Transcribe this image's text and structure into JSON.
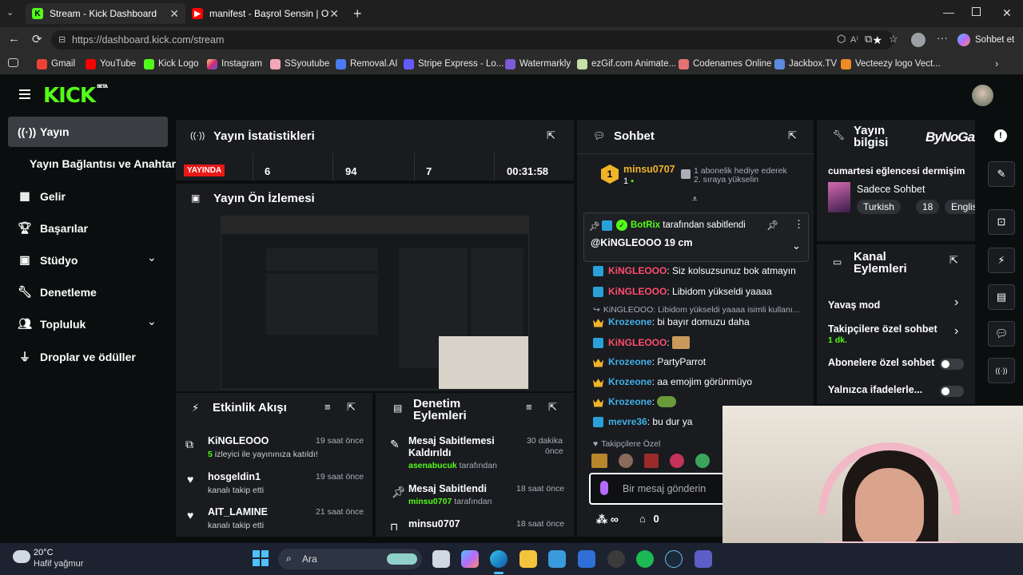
{
  "browser": {
    "tabs": [
      {
        "title": "Stream - Kick Dashboard",
        "active": true
      },
      {
        "title": "manifest - Başrol Sensin | Official M",
        "active": false
      }
    ],
    "url": "https://dashboard.kick.com/stream",
    "sidebar_button": "Sohbet et",
    "bookmarks": [
      "Gmail",
      "YouTube",
      "Kick Logo",
      "Instagram",
      "SSyoutube",
      "Removal.AI",
      "Stripe Express - Lo...",
      "Watermarkly",
      "ezGif.com Animate...",
      "Codenames Online",
      "Jackbox.TV",
      "Vecteezy logo Vect..."
    ]
  },
  "kick": {
    "logo": "KICK",
    "logo_tag": "BETA",
    "sidebar": {
      "items": [
        {
          "label": "Yayın",
          "active": true
        },
        {
          "label": "Yayın Bağlantısı ve Anahtarı"
        },
        {
          "label": "Gelir"
        },
        {
          "label": "Başarılar"
        },
        {
          "label": "Stüdyo"
        },
        {
          "label": "Denetleme"
        },
        {
          "label": "Topluluk"
        },
        {
          "label": "Droplar ve ödüller"
        }
      ]
    },
    "stats": {
      "title": "Yayın İstatistikleri",
      "live_badge": "YAYINDA",
      "values": [
        "6",
        "94",
        "7",
        "00:31:58"
      ]
    },
    "preview": {
      "title": "Yayın Ön İzlemesi"
    },
    "activity": {
      "title": "Etkinlik Akışı",
      "items": [
        {
          "name": "KiNGLEOOO",
          "time": "19 saat önce",
          "count": "5",
          "detail": "izleyici ile yayınınıza katıldı!"
        },
        {
          "name": "hosgeldin1",
          "time": "19 saat önce",
          "detail": "kanalı takip etti"
        },
        {
          "name": "AIT_LAMINE",
          "time": "21 saat önce",
          "detail": "kanalı takip etti"
        }
      ]
    },
    "moderation": {
      "title_line1": "Denetim",
      "title_line2": "Eylemleri",
      "items": [
        {
          "action_line1": "Mesaj Sabitlemesi",
          "action_line2": "Kaldırıldı",
          "time_line1": "30 dakika",
          "time_line2": "önce",
          "user": "asenabucuk",
          "by": "tarafından"
        },
        {
          "action_line1": "Mesaj Sabitlendi",
          "time_line1": "18 saat önce",
          "user": "minsu0707",
          "by": "tarafından"
        },
        {
          "action_line1": "minsu0707",
          "time_line1": "18 saat önce"
        }
      ]
    },
    "chat": {
      "title": "Sohbet",
      "top_gifter": {
        "name": "minsu0707",
        "count": "1",
        "rank": "1",
        "msg_line1": "1 abonelik hediye ederek",
        "msg_line2": "2. sıraya yükselin"
      },
      "pinned": {
        "by": "BotRix",
        "by_suffix": "tarafından sabitlendi",
        "message": "@KiNGLEOOO 19 cm"
      },
      "messages": [
        {
          "user": "KiNGLEOOO",
          "text": "Siz kolsuzsunuz bok atmayın",
          "color": "#ff4d6d",
          "badge": "k"
        },
        {
          "user": "KiNGLEOOO",
          "text": "Libidom yükseldi yaaaa",
          "color": "#ff4d6d",
          "badge": "k"
        },
        {
          "user": "KiNGLEOOO",
          "text": "Libidom yükseldi yaaaa isimli kullanı...",
          "reply": true
        },
        {
          "user": "Krozeone",
          "text": "bi bayır domuzu daha",
          "color": "#3fb1e8",
          "badge": "c"
        },
        {
          "user": "KiNGLEOOO",
          "text": "",
          "color": "#ff4d6d",
          "badge": "k",
          "emote": true
        },
        {
          "user": "Krozeone",
          "text": "PartyParrot",
          "color": "#3fb1e8",
          "badge": "c"
        },
        {
          "user": "Krozeone",
          "text": "aa emojim görünmüyo",
          "color": "#3fb1e8",
          "badge": "c"
        },
        {
          "user": "Krozeone",
          "text": "",
          "color": "#3fb1e8",
          "badge": "c",
          "emote": true
        },
        {
          "user": "mevre36",
          "text": "bu dur ya",
          "color": "#3fb1e8",
          "badge": "k"
        }
      ],
      "followers_only": "Takipçilere Özel",
      "input_placeholder": "Bir mesaj gönderin",
      "viewer_count": "∞",
      "points": "0"
    },
    "stream_info": {
      "title_line1": "Yayın",
      "title_line2": "bilgisi",
      "stream_title": "cumartesi eğlencesi dermişim",
      "category": "Sadece Sohbet",
      "tags": [
        "Turkish",
        "18",
        "English"
      ],
      "overlay_logo": "ByNoGame"
    },
    "channel_actions": {
      "title_line1": "Kanal",
      "title_line2": "Eylemleri",
      "items": [
        {
          "label": "Yavaş mod"
        },
        {
          "label": "Takipçilere özel sohbet",
          "sub": "1 dk."
        },
        {
          "label": "Abonelere özel sohbet"
        },
        {
          "label": "Yalnızca ifadelerle..."
        }
      ]
    }
  },
  "taskbar": {
    "weather_temp": "20°C",
    "weather_desc": "Hafif yağmur",
    "search_placeholder": "Ara"
  }
}
